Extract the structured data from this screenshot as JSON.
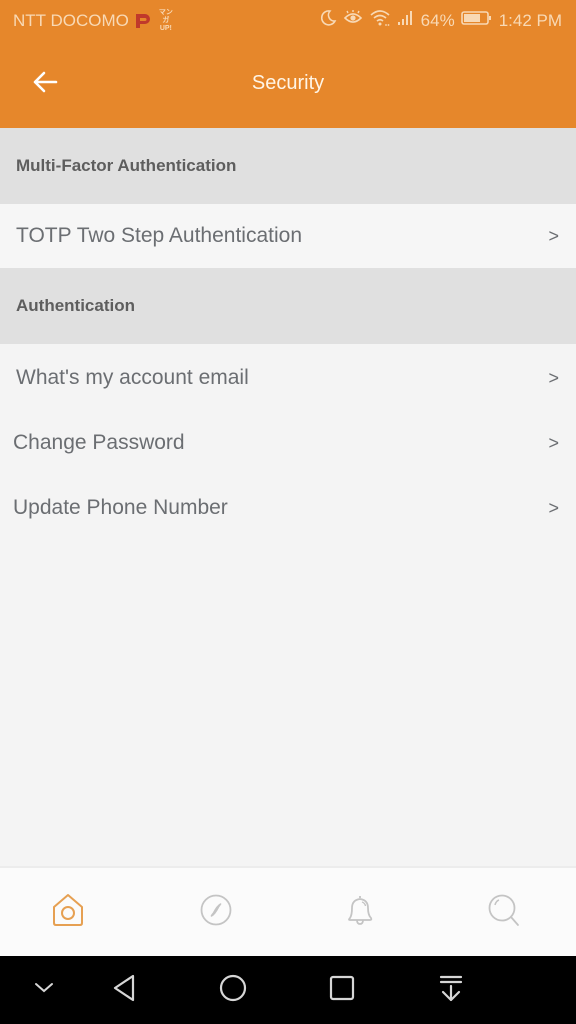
{
  "status_bar": {
    "carrier": "NTT DOCOMO",
    "manga_badge": "マンガ UP!",
    "battery": "64%",
    "time": "1:42 PM",
    "icons": [
      "do-not-disturb-moon-icon",
      "eye-comfort-icon",
      "wifi-icon",
      "signal-icon",
      "battery-icon"
    ]
  },
  "app_bar": {
    "title": "Security",
    "back_icon": "arrow-left-icon"
  },
  "sections": [
    {
      "header": "Multi-Factor Authentication",
      "items": [
        {
          "label": "TOTP Two Step Authentication",
          "chevron": ">"
        }
      ]
    },
    {
      "header": "Authentication",
      "items": [
        {
          "label": "What's my account email",
          "chevron": ">"
        },
        {
          "label": "Change Password",
          "chevron": ">"
        },
        {
          "label": "Update Phone Number",
          "chevron": ">"
        }
      ]
    }
  ],
  "bottom_nav": {
    "items": [
      {
        "name": "home",
        "icon": "home-icon",
        "active": true
      },
      {
        "name": "explore",
        "icon": "compass-icon",
        "active": false
      },
      {
        "name": "notifications",
        "icon": "bell-icon",
        "active": false
      },
      {
        "name": "search",
        "icon": "search-icon",
        "active": false
      }
    ]
  },
  "system_nav": {
    "items": [
      "hide-nav-chevron-icon",
      "back-triangle-icon",
      "home-circle-icon",
      "recents-square-icon",
      "notification-pull-icon"
    ]
  },
  "colors": {
    "accent": "#e6872b",
    "section_bg": "#e0e0e0",
    "page_bg": "#f4f4f4",
    "text": "#6b6e72",
    "header_text": "#5e5e5e",
    "inactive_icon": "#c4c4c4"
  }
}
